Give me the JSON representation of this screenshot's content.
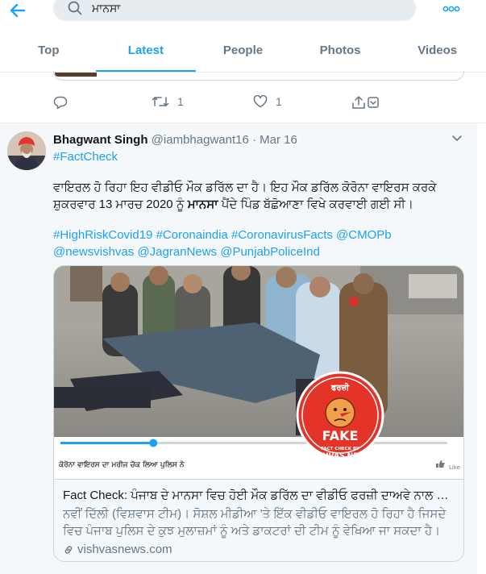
{
  "search": {
    "value": "ਮਾਨਸਾ"
  },
  "tabs": [
    {
      "label": "Top"
    },
    {
      "label": "Latest"
    },
    {
      "label": "People"
    },
    {
      "label": "Photos"
    },
    {
      "label": "Videos"
    }
  ],
  "active_tab": "Latest",
  "previous_tweet": {
    "retweets": "1",
    "likes": "1"
  },
  "tweet": {
    "name": "Bhagwant Singh",
    "handle": "@iambhagwant16",
    "dot": "·",
    "date": "Mar 16",
    "hashtag_top": "#FactCheck",
    "body_part1": "ਵਾਇਰਲ ਹੋ ਰਿਹਾ ਇਹ ਵੀਡੀਓ ਮੌਕ ਡਰਿੱਲ ਦਾ ਹੈ। ਇਹ ਮੌਕ ਡਰਿੱਲ ਕੋਰੋਨਾ ਵਾਇਰਸ ਕਰਕੇ ਸ਼ੁਕਰਵਾਰ 13 ਮਾਰਚ 2020 ਨੂੰ ",
    "body_bold": "ਮਾਨਸਾ",
    "body_part2": " ਪੈਂਦੇ ਪਿੰਡ ਬੱਛੋਆਣਾ ਵਿਖੇ ਕਰਵਾਈ ਗਈ ਸੀ।",
    "tags": [
      "#HighRiskCovid19",
      "#Coronaindia",
      "#CoronavirusFacts",
      "@CMOPb",
      "@newsvishvas",
      "@JagranNews",
      "@PunjabPoliceInd"
    ]
  },
  "card": {
    "video_caption": "ਕੋਰੋਨਾ ਵਾਇਰਸ ਦਾ ਮਰੀਜ ਚੱਕ ਲਿਆ ਪੁਲਿਸ ਨੇ",
    "stamp_top": "ਫਰਜ਼ੀ",
    "stamp_word": "FAKE",
    "stamp_by": "FACT CHECK BY",
    "stamp_brand": "VISHVAS NEWS",
    "like_label": "Like",
    "title": "Fact Check: ਪੰਜਾਬ ਦੇ ਮਾਨਸਾ ਵਿਚ ਹੋਈ ਮੌਕ ਡਰਿੱਲ ਦਾ ਵੀਡੀਓ ਫਰਜ਼ੀ ਦਾਅਵੇ ਨਾਲ ਵਾਇਰਲ - Vi...",
    "description": "ਨਵੀਂ ਦਿੱਲੀ (ਵਿਸ਼ਵਾਸ ਟੀਮ)। ਸੋਸ਼ਲ ਮੀਡੀਆ 'ਤੇ ਇੱਕ ਵੀਡੀਓ ਵਾਇਰਲ ਹੋ ਰਿਹਾ ਹੈ ਜਿਸਦੇ ਵਿਚ ਪੰਜਾਬ ਪੁਲਿਸ ਦੇ ਕੁਝ ਮੁਲਾਜ਼ਮਾਂ ਨੂੰ ਅਤੇ ਡਾਕਟਰਾਂ ਦੀ ਟੀਮ ਨੂੰ ਵੇਖਿਆ ਜਾ ਸਕਦਾ ਹੈ। ਇਸ ਵੀਡੀਓ ਵਿਚ ਉਹ ਰਾਹ ...",
    "domain": "vishvasnews.com",
    "video_progress": 0.24
  },
  "colors": {
    "accent": "#1da1f2",
    "muted": "#657786",
    "text": "#14171a",
    "fake_red": "#e4342a"
  },
  "icons": [
    "back-arrow-icon",
    "search-icon",
    "more-icon",
    "reply-icon",
    "retweet-icon",
    "like-icon",
    "share-icon",
    "chevron-down-icon",
    "link-icon"
  ]
}
